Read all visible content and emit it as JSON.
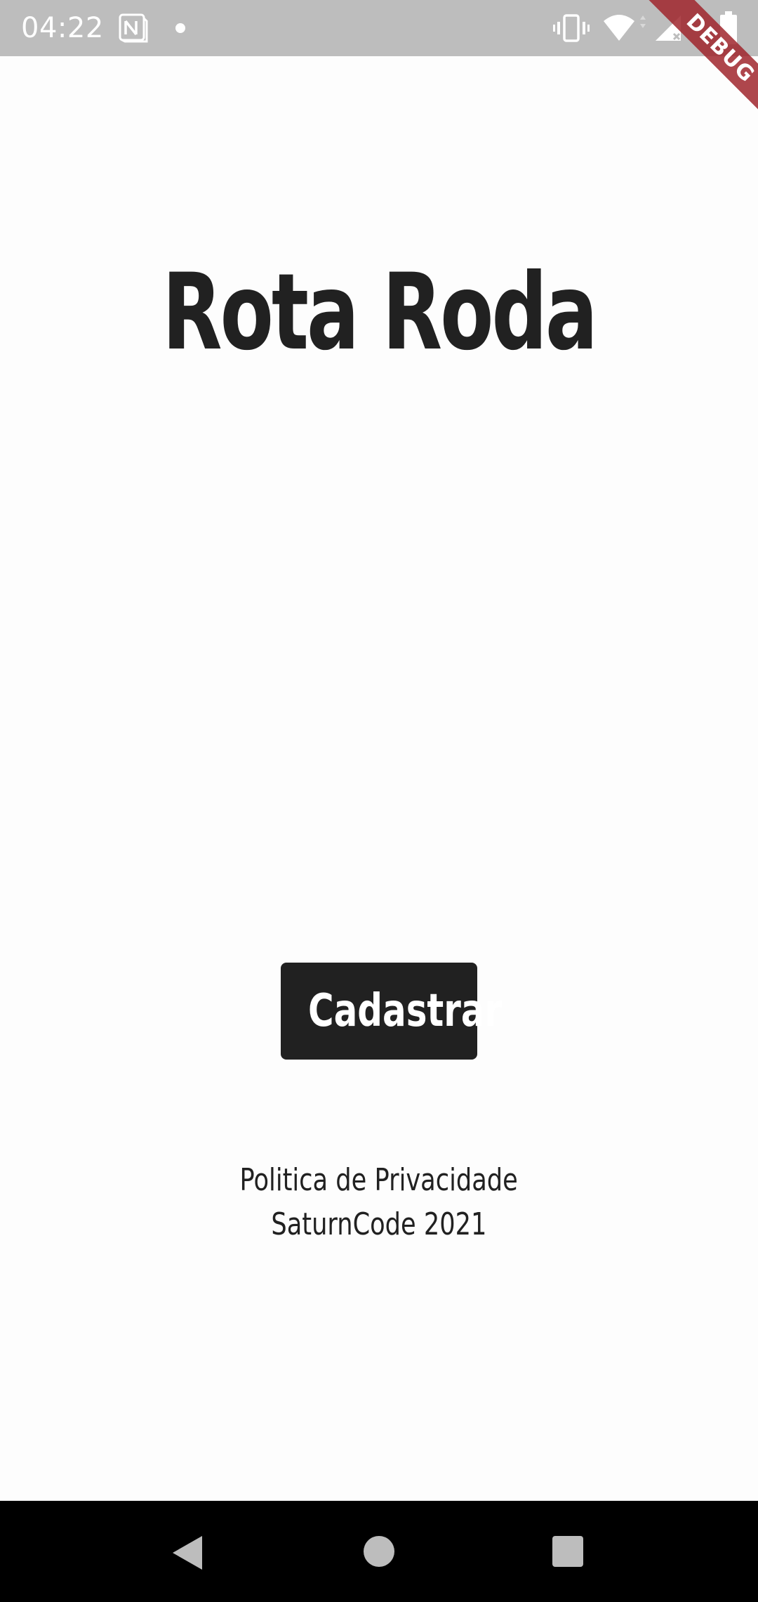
{
  "status_bar": {
    "time": "04:22",
    "icons": [
      "notion-icon",
      "dot-icon",
      "vibrate-icon",
      "wifi-icon",
      "signal-icon",
      "battery-icon"
    ]
  },
  "debug_banner": {
    "label": "DEBUG"
  },
  "main": {
    "title": "Rota Roda",
    "register_button_label": "Cadastrar",
    "privacy_link": "Politica de Privacidade",
    "footer": "SaturnCode 2021"
  },
  "nav_bar": {
    "icons": [
      "back-icon",
      "home-icon",
      "recents-icon"
    ]
  },
  "colors": {
    "background": "#fdfdfd",
    "status_bar": "#bdbdbd",
    "text": "#212121",
    "button": "#212121",
    "button_text": "#ffffff",
    "debug_banner": "#a0262d",
    "nav_bar": "#000000"
  }
}
